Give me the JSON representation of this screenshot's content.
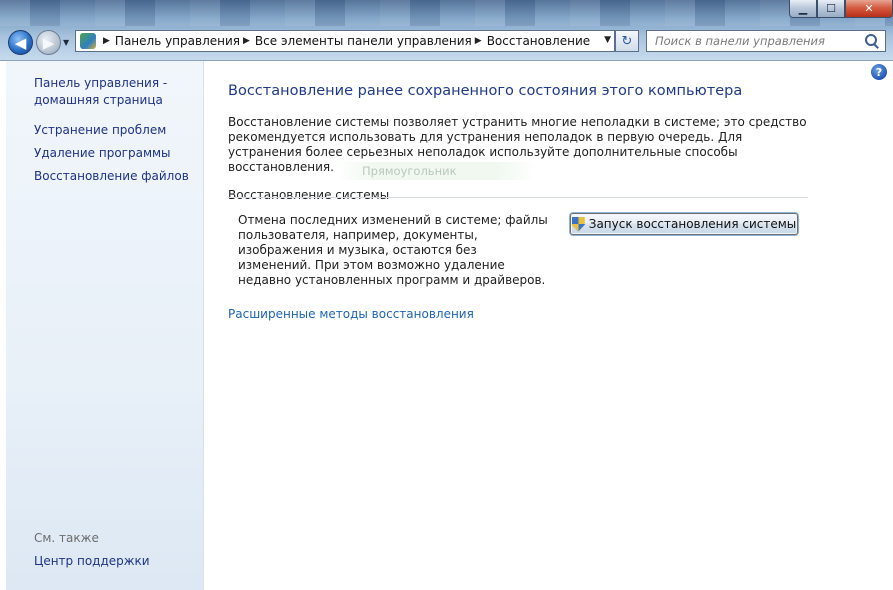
{
  "window": {
    "controls": {
      "minimize": "▁",
      "maximize": "☐",
      "close": "✕"
    }
  },
  "nav": {
    "back_label": "◀",
    "forward_label": "▶",
    "breadcrumbs": [
      "Панель управления",
      "Все элементы панели управления",
      "Восстановление"
    ],
    "refresh_label": "↻",
    "search_placeholder": "Поиск в панели управления"
  },
  "sidebar": {
    "items": [
      {
        "label": "Панель управления - домашняя страница"
      },
      {
        "label": "Устранение проблем"
      },
      {
        "label": "Удаление программы"
      },
      {
        "label": "Восстановление файлов"
      }
    ],
    "see_also_title": "См. также",
    "see_also_items": [
      {
        "label": "Центр поддержки"
      }
    ]
  },
  "main": {
    "help_label": "?",
    "title": "Восстановление ранее сохраненного состояния этого компьютера",
    "intro": "Восстановление системы позволяет устранить многие неполадки в системе; это средство рекомендуется использовать для устранения неполадок в первую очередь. Для устранения более серьезных неполадок используйте дополнительные способы восстановления.",
    "ghost_tooltip": "Прямоугольник",
    "section": {
      "title": "Восстановление системы",
      "description": "Отмена последних изменений в системе; файлы пользователя, например, документы, изображения и музыка, остаются без изменений. При этом возможно удаление недавно установленных программ и драйверов.",
      "button_label": "Запуск восстановления системы"
    },
    "advanced_link": "Расширенные методы восстановления"
  },
  "colors": {
    "link": "#1e3287",
    "title": "#1f3a8a",
    "accent_link": "#1e64b4"
  }
}
